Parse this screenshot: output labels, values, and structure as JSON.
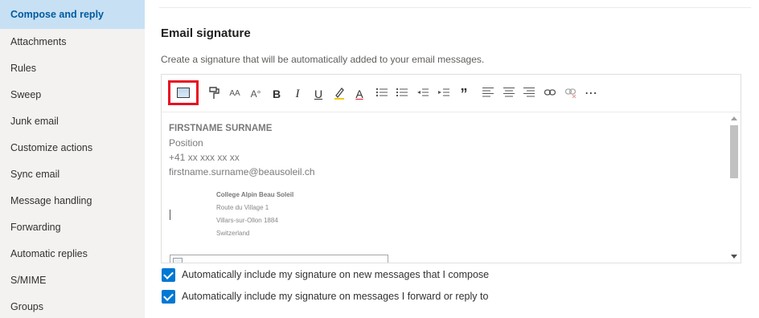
{
  "sidebar": {
    "items": [
      {
        "label": "Compose and reply",
        "active": true
      },
      {
        "label": "Attachments"
      },
      {
        "label": "Rules"
      },
      {
        "label": "Sweep"
      },
      {
        "label": "Junk email"
      },
      {
        "label": "Customize actions"
      },
      {
        "label": "Sync email"
      },
      {
        "label": "Message handling"
      },
      {
        "label": "Forwarding"
      },
      {
        "label": "Automatic replies"
      },
      {
        "label": "S/MIME"
      },
      {
        "label": "Groups"
      }
    ]
  },
  "main": {
    "heading": "Email signature",
    "description": "Create a signature that will be automatically added to your email messages.",
    "toolbar": {
      "icons": [
        "insert-image-icon",
        "format-painter-icon",
        "font-size-icon",
        "text-effects-icon",
        "bold-icon",
        "italic-icon",
        "underline-icon",
        "highlight-icon",
        "font-color-icon",
        "bullets-icon",
        "numbering-icon",
        "decrease-indent-icon",
        "increase-indent-icon",
        "quote-icon",
        "align-left-icon",
        "align-center-icon",
        "align-right-icon",
        "insert-link-icon",
        "remove-link-icon",
        "more-icon"
      ],
      "bold": "B",
      "italic": "I",
      "underline": "U",
      "font_color": "A",
      "quote": "”",
      "more": "⋯",
      "font_size": "AA",
      "text_effects": "A°"
    },
    "signature": {
      "name": "FIRSTNAME SURNAME",
      "position": "Position",
      "phone": "+41 xx xxx xx xx",
      "email": "firstname.surname@beausoleil.ch",
      "school": "College Alpin Beau Soleil",
      "address1": "Route du Village 1",
      "address2": "Villars-sur-Ollon 1884",
      "country": "Switzerland"
    },
    "options": [
      {
        "label": "Automatically include my signature on new messages that I compose",
        "checked": true
      },
      {
        "label": "Automatically include my signature on messages I forward or reply to",
        "checked": true
      }
    ]
  },
  "colors": {
    "accent": "#0078d4",
    "highlight_box": "#e81123",
    "sidebar_active": "#c7e0f4",
    "sidebar_bg": "#f3f2f1"
  }
}
